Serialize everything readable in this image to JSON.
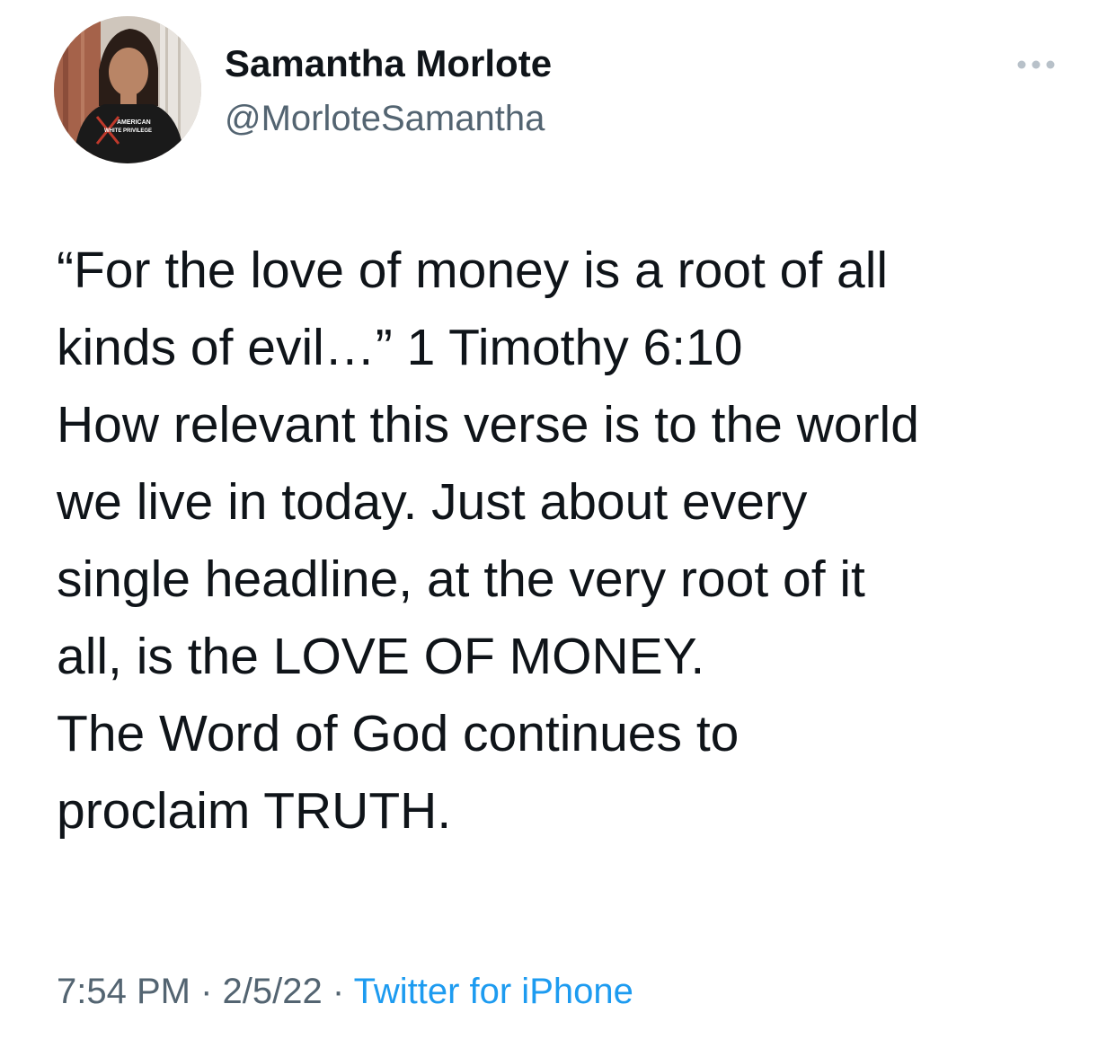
{
  "author": {
    "name": "Samantha Morlote",
    "handle": "@MorloteSamantha",
    "avatar_shirt_text": [
      "AMERICAN",
      "WHITE PRIVILEGE"
    ]
  },
  "menu": {
    "icon": "more-horizontal-icon"
  },
  "tweet": {
    "paragraphs": [
      "“For the love of money is a root of all\nkinds of evil…” 1 Timothy 6:10",
      "How relevant this verse is to the world\nwe live in today. Just about every\nsingle headline, at the very root of it\nall, is the LOVE OF MONEY.",
      "The Word of God continues to\nproclaim TRUTH."
    ],
    "time": "7:54 PM",
    "separator": "·",
    "date": "2/5/22",
    "source": "Twitter for iPhone"
  },
  "colors": {
    "text": "#0f1419",
    "secondary": "#536471",
    "link": "#1d9bf0",
    "background": "#ffffff"
  }
}
